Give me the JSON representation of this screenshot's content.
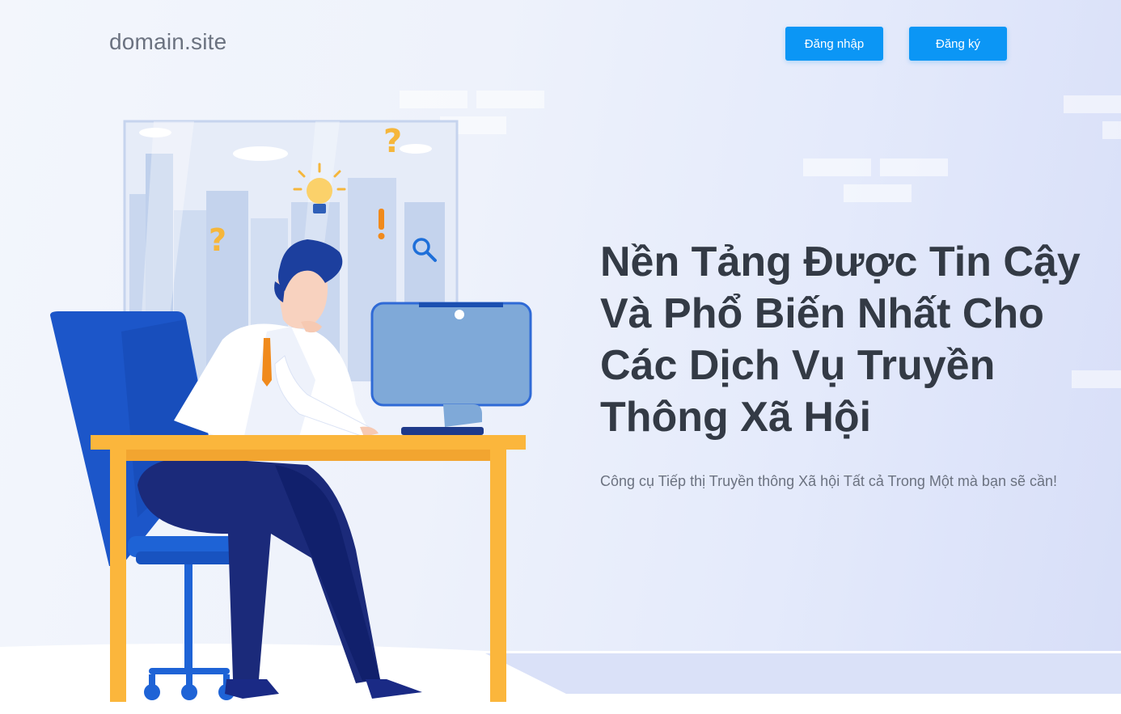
{
  "header": {
    "logo_text": "domain.site",
    "login_label": "Đăng nhập",
    "register_label": "Đăng ký"
  },
  "hero": {
    "title": "Nền Tảng Được Tin Cậy Và Phổ Biến Nhất Cho Các Dịch Vụ Truyền Thông Xã Hội",
    "subtitle": "Công cụ Tiếp thị Truyền thông Xã hội Tất cả Trong Một mà bạn sẽ cần!"
  },
  "colors": {
    "accent": "#0b96f5",
    "title": "#333a45",
    "muted": "#6b7280",
    "desk": "#fbb63c",
    "chair": "#1a5bd1",
    "pants": "#1b2a7a",
    "monitor": "#7fa9d8"
  },
  "icons": [
    "question-mark-icon",
    "lightbulb-icon",
    "exclamation-icon",
    "magnifier-icon"
  ]
}
